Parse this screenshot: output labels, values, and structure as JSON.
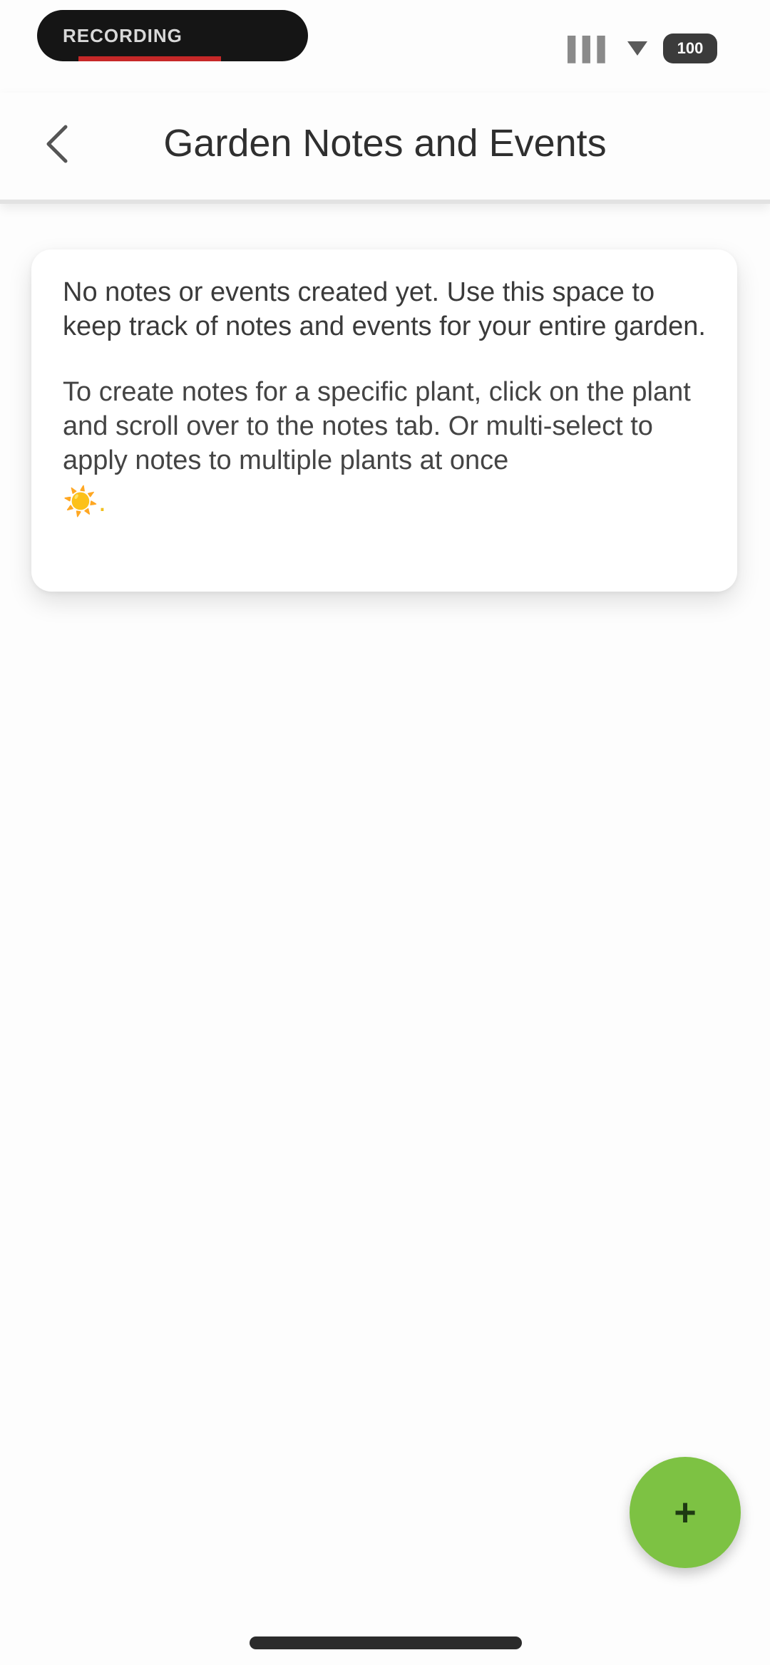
{
  "status_bar": {
    "recording_label": "RECORDING",
    "signal": "▌▌▌",
    "battery": "100"
  },
  "header": {
    "title": "Garden Notes and Events"
  },
  "empty_state": {
    "paragraph1": "No notes or events created yet. Use this space to keep track of notes and events for your entire garden.",
    "paragraph2": "To create notes for a specific plant, click on the plant and scroll over to the notes tab. Or multi-select to apply notes to multiple plants at once",
    "emoji": "☀️",
    "trailing": "."
  },
  "fab": {
    "icon": "plus-icon",
    "symbol": "+",
    "color": "#7dc243"
  },
  "colors": {
    "accent": "#7dc243",
    "background": "#fdfdfd"
  }
}
